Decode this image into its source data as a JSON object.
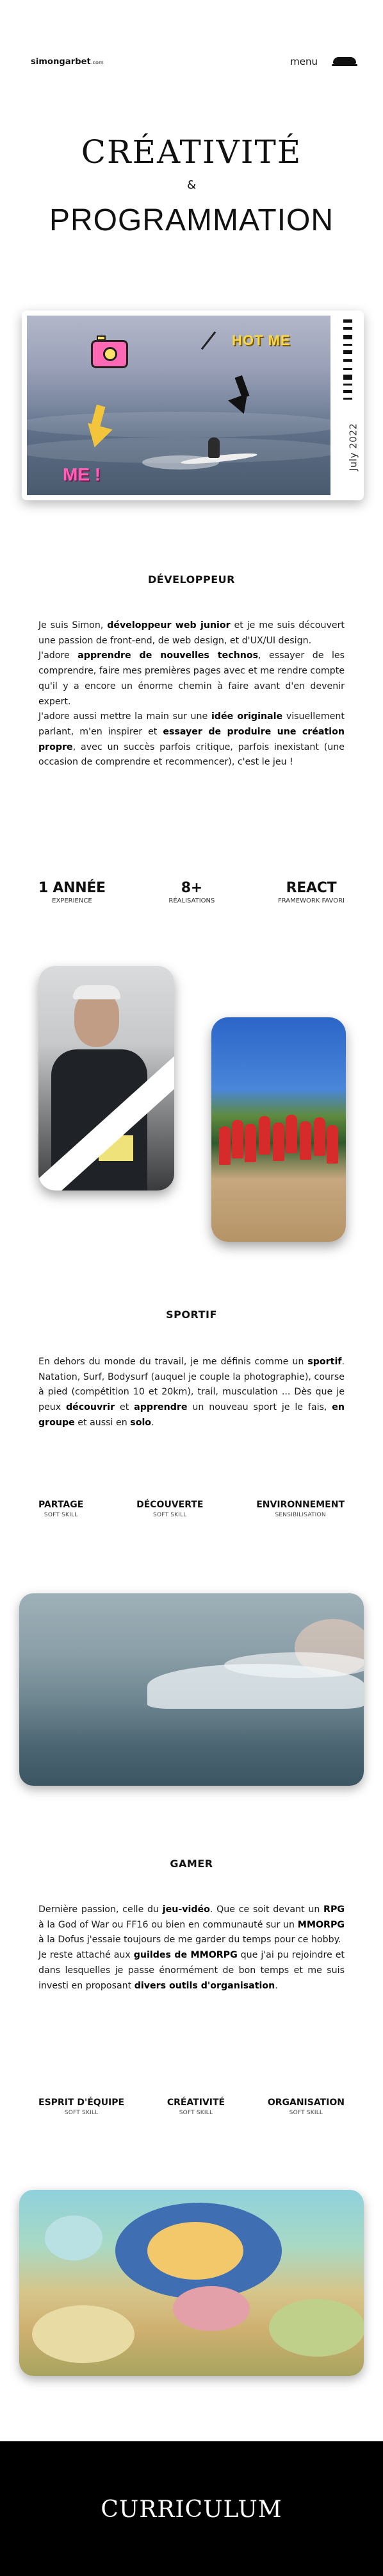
{
  "header": {
    "logo_main": "simongarbet",
    "logo_suffix": ".com",
    "menu_label": "menu",
    "menu_icon": "cap-icon"
  },
  "hero": {
    "line1": "CRÉATIVITÉ",
    "amp": "&",
    "line2": "PROGRAMMATION"
  },
  "hero_card": {
    "date": "July 2022",
    "sticker_hot": "HOT ME",
    "sticker_me": "ME !"
  },
  "developer": {
    "title": "DÉVELOPPEUR",
    "paragraph": [
      {
        "t": "Je suis Simon, ",
        "b": false
      },
      {
        "t": "développeur web junior",
        "b": true
      },
      {
        "t": " et je me suis découvert une passion de front-end, de web design, et d'UX/UI design.",
        "b": false
      },
      {
        "t": "\nJ'adore ",
        "b": false
      },
      {
        "t": "apprendre de nouvelles technos",
        "b": true
      },
      {
        "t": ", essayer de les comprendre, faire mes premières pages avec et me rendre compte qu'il y a encore un énorme chemin à faire avant d'en devenir expert.",
        "b": false
      },
      {
        "t": "\nJ'adore aussi mettre la main sur une ",
        "b": false
      },
      {
        "t": "idée originale",
        "b": true
      },
      {
        "t": " visuellement parlant, m'en inspirer et ",
        "b": false
      },
      {
        "t": "essayer de produire une création propre",
        "b": true
      },
      {
        "t": ", avec un succès parfois critique, parfois inexistant (une occasion de comprendre et recommencer), c'est le jeu !",
        "b": false
      }
    ],
    "stats": [
      {
        "value": "1 ANNÉE",
        "label": "EXPERIENCE"
      },
      {
        "value": "8+",
        "label": "RÉALISATIONS"
      },
      {
        "value": "REACT",
        "label": "FRAMEWORK FAVORI"
      }
    ]
  },
  "sport": {
    "title": "SPORTIF",
    "paragraph": [
      {
        "t": "En dehors du monde du travail, je me définis comme un ",
        "b": false
      },
      {
        "t": "sportif",
        "b": true
      },
      {
        "t": ". Natation, Surf, Bodysurf (auquel je couple la photographie), course à pied (compétition 10 et 20km), trail, musculation ... Dès que je peux ",
        "b": false
      },
      {
        "t": "découvrir",
        "b": true
      },
      {
        "t": " et ",
        "b": false
      },
      {
        "t": "apprendre",
        "b": true
      },
      {
        "t": " un nouveau sport je le fais, ",
        "b": false
      },
      {
        "t": "en groupe",
        "b": true
      },
      {
        "t": " et aussi en ",
        "b": false
      },
      {
        "t": "solo",
        "b": true
      },
      {
        "t": ".",
        "b": false
      }
    ],
    "skills": [
      {
        "value": "PARTAGE",
        "label": "SOFT SKILL"
      },
      {
        "value": "DÉCOUVERTE",
        "label": "SOFT SKILL"
      },
      {
        "value": "ENVIRONNEMENT",
        "label": "SENSIBILISATION"
      }
    ]
  },
  "gamer": {
    "title": "GAMER",
    "paragraph": [
      {
        "t": "Dernière passion, celle du ",
        "b": false
      },
      {
        "t": "jeu-vidéo",
        "b": true
      },
      {
        "t": ". Que ce soit devant un ",
        "b": false
      },
      {
        "t": "RPG",
        "b": true
      },
      {
        "t": " à la God of War ou FF16 ou bien en communauté sur un ",
        "b": false
      },
      {
        "t": "MMORPG",
        "b": true
      },
      {
        "t": " à la Dofus j'essaie toujours de me garder du temps pour ce hobby.",
        "b": false
      },
      {
        "t": "\nJe reste attaché aux ",
        "b": false
      },
      {
        "t": "guildes de MMORPG",
        "b": true
      },
      {
        "t": " que j'ai pu rejoindre et dans lesquelles je passe énormément de bon temps et me suis investi en proposant ",
        "b": false
      },
      {
        "t": "divers outils d'organisation",
        "b": true
      },
      {
        "t": ".",
        "b": false
      }
    ],
    "skills": [
      {
        "value": "ESPRIT D'ÉQUIPE",
        "label": "SOFT SKILL"
      },
      {
        "value": "CRÉATIVITÉ",
        "label": "SOFT SKILL"
      },
      {
        "value": "ORGANISATION",
        "label": "SOFT SKILL"
      }
    ]
  },
  "footer": {
    "title": "CURRICULUM"
  }
}
